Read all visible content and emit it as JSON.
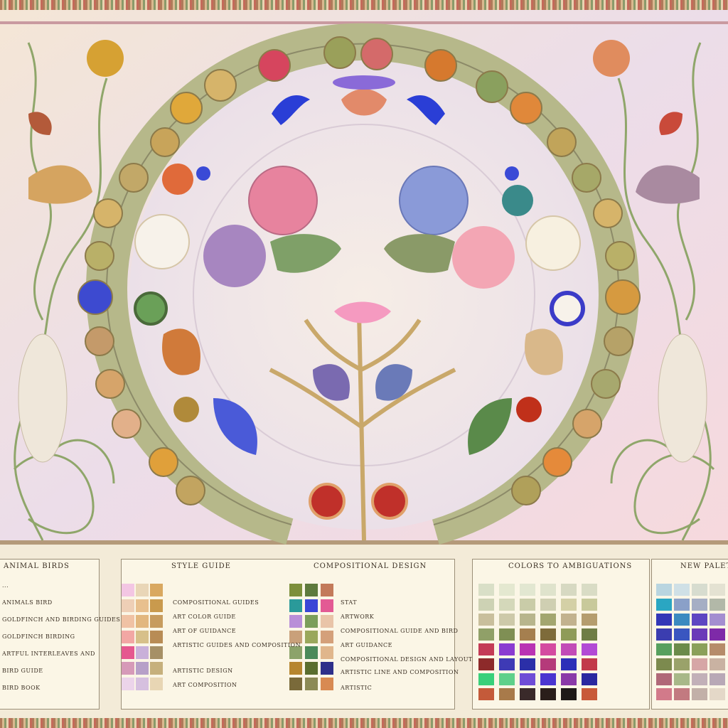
{
  "panels": [
    {
      "title": "ANIMAL BIRDS",
      "rows": [
        "...",
        "ANIMALS BIRD",
        "GOLDFINCH AND BIRDING GUIDES",
        "GOLDFINCH BIRDING",
        "ARTFUL INTERLEAVES AND",
        "BIRD GUIDE",
        "BIRD BOOK"
      ]
    },
    {
      "title": "STYLE GUIDE",
      "title2": "COMPOSITIONAL DESIGN",
      "left_rows": [
        "COMPOSITIONAL GUIDES",
        "ART COLOR GUIDE",
        "ART OF GUIDANCE",
        "ARTISTIC GUIDES AND COMPOSITION",
        "ARTISTIC DESIGN",
        "ART COMPOSITION"
      ],
      "right_rows": [
        "STAT",
        "ARTWORK",
        "COMPOSITIONAL GUIDE AND BIRD",
        "ART GUIDANCE",
        "COMPOSITIONAL DESIGN AND LAYOUT",
        "ARTISTIC LINE AND COMPOSITION",
        "ARTISTIC"
      ]
    },
    {
      "title": "COLORS TO AMBIGUATIONS"
    },
    {
      "title": "NEW PALETTE"
    }
  ],
  "colors": {
    "background": "#f3ebd8",
    "ring": "#b6b88a",
    "panel_bg": "#fbf6e6",
    "panel_border": "#9b8f78"
  },
  "swatches": {
    "style_left": [
      "#f3c6e3",
      "#e9d6b7",
      "#d9a860",
      "#eecfb6",
      "#e8c08e",
      "#c99a4d",
      "#f0c2a4",
      "#e2b77e",
      "#c79c5e",
      "#f2a7a4",
      "#d7c08a",
      "#b88c55",
      "#e5588f",
      "#c9b0d9",
      "#a69066",
      "#d69ab8",
      "#b7a0c8",
      "#c6b07c",
      "#ecd4ea",
      "#d6c0df",
      "#e8d6b4"
    ],
    "style_right": [
      "#7d8f3b",
      "#5e7a3d",
      "#c37a5a",
      "#2a9a9a",
      "#3a46d6",
      "#e35a94",
      "#b98fd8",
      "#7b9e5a",
      "#e9c4a8",
      "#c9a07a",
      "#9aa85c",
      "#d4a07a",
      "#8ca36a",
      "#4b8a5a",
      "#e0b68c",
      "#b6862f",
      "#5a6e2e",
      "#2e2f8a",
      "#7a6a3a",
      "#8c8a55",
      "#d88a52"
    ],
    "colors_ambig": [
      "#d9dfc7",
      "#e4e8d0",
      "#e2e7d1",
      "#dfe3cc",
      "#d7d9c2",
      "#d9dcc5",
      "#cdd2b4",
      "#d4d8ba",
      "#c9cca8",
      "#cfcfb2",
      "#d4d0a6",
      "#c8c99b",
      "#c9bf9c",
      "#cdc9a9",
      "#b8b58c",
      "#a3a66f",
      "#c2b28e",
      "#b59d6e",
      "#90a068",
      "#7f8f54",
      "#a57f4f",
      "#7e6b3a",
      "#8f9b58",
      "#6f7d45",
      "#c43b56",
      "#8a3bd1",
      "#b933b3",
      "#d44aa0",
      "#c24bb7",
      "#b24ad5",
      "#8d2a2a",
      "#3e3ab5",
      "#2b2fa8",
      "#b53a7a",
      "#2c2eb8",
      "#c23a4a",
      "#39d07a",
      "#5fd08a",
      "#6f4dd6",
      "#4a35d0",
      "#8a3aa8",
      "#2a28a0",
      "#c45a3a",
      "#a87a4a",
      "#3a2a2a",
      "#2a1e1a",
      "#1e1a18",
      "#c85a3a"
    ],
    "palette": [
      "#b9d5e0",
      "#cfe0e6",
      "#d7dccf",
      "#e4e2d2",
      "#2aa6c2",
      "#8aa0c8",
      "#a5aec4",
      "#b2b8a8",
      "#3237b7",
      "#3b8ac0",
      "#5e46c2",
      "#a48ed0",
      "#3b3db0",
      "#3a56c0",
      "#6b3ab8",
      "#7e2aa8",
      "#57a05e",
      "#6b8b4a",
      "#8ba05a",
      "#b68c6a",
      "#7c8a4e",
      "#9aa26a",
      "#d6a6a6",
      "#c9b2a2",
      "#b06878",
      "#a8b888",
      "#c2b0b8",
      "#b8a8b6",
      "#d27a8a",
      "#c27a80",
      "#c2b0a8",
      "#e4d8c8"
    ]
  }
}
